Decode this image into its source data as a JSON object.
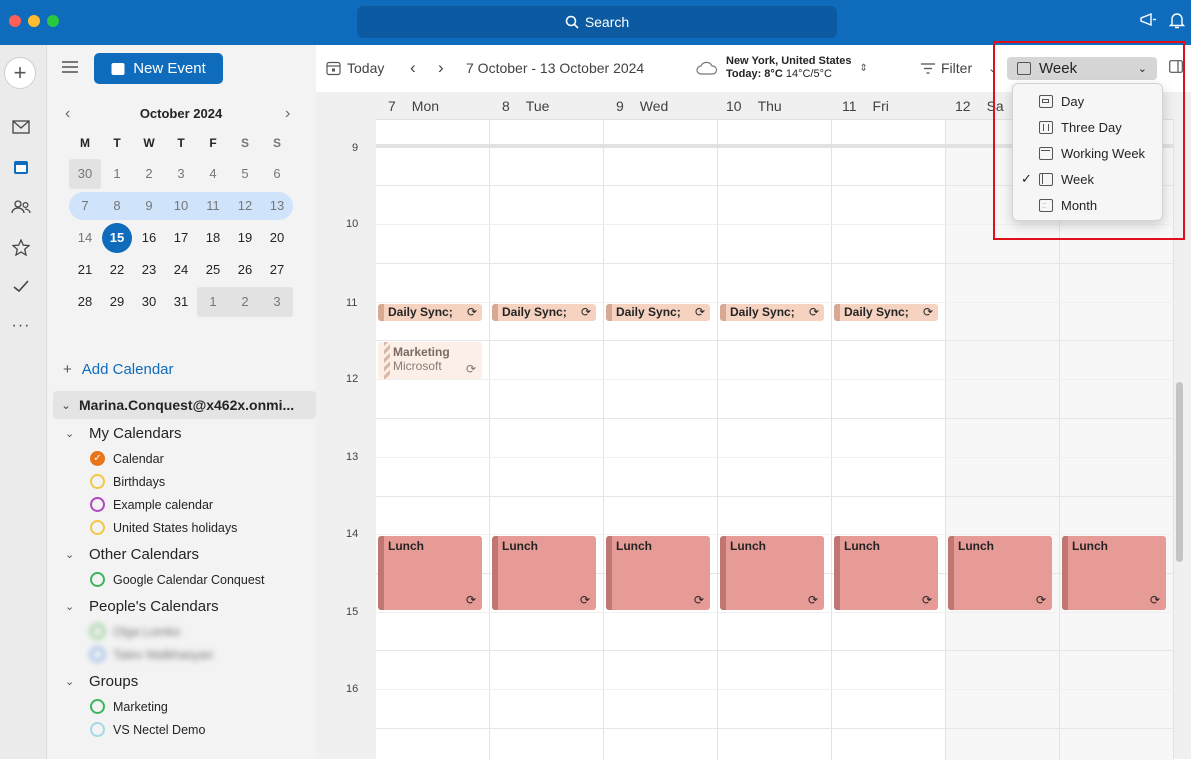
{
  "titlebar": {
    "search_label": "Search"
  },
  "toolbar": {
    "new_event": "New Event",
    "today": "Today",
    "date_range": "7 October - 13 October 2024",
    "weather_location": "New York, United States",
    "weather_today": "Today: 8°C",
    "weather_range": "14°C/5°C",
    "filter": "Filter",
    "view": "Week"
  },
  "mini_calendar": {
    "month": "October 2024",
    "weekdays": [
      "M",
      "T",
      "W",
      "T",
      "F",
      "S",
      "S"
    ],
    "weeks": [
      [
        "30",
        "1",
        "2",
        "3",
        "4",
        "5",
        "6"
      ],
      [
        "7",
        "8",
        "9",
        "10",
        "11",
        "12",
        "13"
      ],
      [
        "14",
        "15",
        "16",
        "17",
        "18",
        "19",
        "20"
      ],
      [
        "21",
        "22",
        "23",
        "24",
        "25",
        "26",
        "27"
      ],
      [
        "28",
        "29",
        "30",
        "31",
        "1",
        "2",
        "3"
      ]
    ],
    "today": "15"
  },
  "sidebar": {
    "add_calendar": "Add Calendar",
    "account": "Marina.Conquest@x462x.onmi...",
    "my_calendars": {
      "label": "My Calendars",
      "items": [
        "Calendar",
        "Birthdays",
        "Example calendar",
        "United States holidays"
      ],
      "colors": [
        "#e8751a",
        "#f2c744",
        "#b146c2",
        "#f2c744"
      ]
    },
    "other_calendars": {
      "label": "Other Calendars",
      "items": [
        "Google Calendar Conquest"
      ]
    },
    "peoples_calendars": {
      "label": "People's Calendars",
      "items": [
        "Olga Lomko",
        "Tatev Malkhasyan"
      ]
    },
    "groups": {
      "label": "Groups",
      "items": [
        "Marketing",
        "VS Nectel Demo"
      ]
    }
  },
  "week": {
    "days": [
      {
        "num": "7",
        "name": "Mon"
      },
      {
        "num": "8",
        "name": "Tue"
      },
      {
        "num": "9",
        "name": "Wed"
      },
      {
        "num": "10",
        "name": "Thu"
      },
      {
        "num": "11",
        "name": "Fri"
      },
      {
        "num": "12",
        "name": "Sa"
      }
    ],
    "hours": [
      "9",
      "10",
      "11",
      "12",
      "13",
      "14",
      "15",
      "16"
    ]
  },
  "events": {
    "daily_sync": "Daily Sync;",
    "lunch": "Lunch",
    "marketing_title": "Marketing",
    "marketing_org": "Microsoft"
  },
  "view_menu": {
    "items": [
      "Day",
      "Three Day",
      "Working Week",
      "Week",
      "Month"
    ],
    "selected": "Week"
  },
  "colors": {
    "accent": "#0f6cbd",
    "lunch": "#e69b97",
    "sync": "#f6d2c0",
    "highlight": "#e0101a"
  }
}
